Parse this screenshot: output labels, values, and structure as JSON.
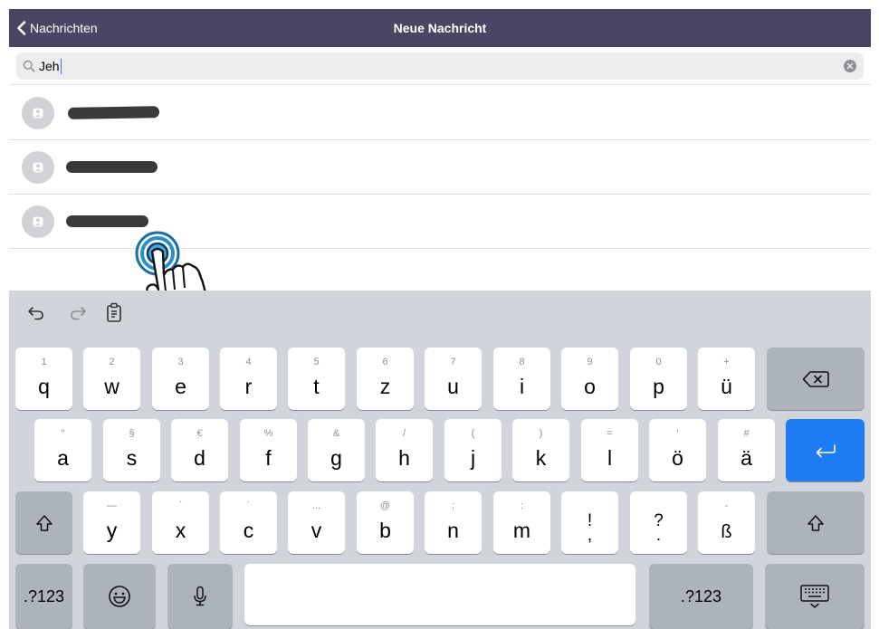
{
  "navbar": {
    "back_label": "Nachrichten",
    "title": "Neue Nachricht",
    "bg_color": "#4a4563"
  },
  "search": {
    "value": "Jeh",
    "icon": "search-icon",
    "clear_icon": "clear-icon"
  },
  "contacts": [
    {
      "name": "",
      "avatar_icon": "person-icon",
      "redacted": true
    },
    {
      "name": "",
      "avatar_icon": "person-icon",
      "redacted": true
    },
    {
      "name": "",
      "avatar_icon": "person-icon",
      "redacted": true
    }
  ],
  "overlay": {
    "icon": "tap-gesture-hand-icon"
  },
  "keyboard": {
    "toolbar": [
      "undo-icon",
      "redo-icon",
      "paste-icon"
    ],
    "row1": [
      {
        "primary": "q",
        "secondary": "1"
      },
      {
        "primary": "w",
        "secondary": "2"
      },
      {
        "primary": "e",
        "secondary": "3"
      },
      {
        "primary": "r",
        "secondary": "4"
      },
      {
        "primary": "t",
        "secondary": "5"
      },
      {
        "primary": "z",
        "secondary": "6"
      },
      {
        "primary": "u",
        "secondary": "7"
      },
      {
        "primary": "i",
        "secondary": "8"
      },
      {
        "primary": "o",
        "secondary": "9"
      },
      {
        "primary": "p",
        "secondary": "0"
      },
      {
        "primary": "ü",
        "secondary": "+"
      }
    ],
    "row2": [
      {
        "primary": "a",
        "secondary": "\""
      },
      {
        "primary": "s",
        "secondary": "§"
      },
      {
        "primary": "d",
        "secondary": "€"
      },
      {
        "primary": "f",
        "secondary": "%"
      },
      {
        "primary": "g",
        "secondary": "&"
      },
      {
        "primary": "h",
        "secondary": "/"
      },
      {
        "primary": "j",
        "secondary": "("
      },
      {
        "primary": "k",
        "secondary": ")"
      },
      {
        "primary": "l",
        "secondary": "="
      },
      {
        "primary": "ö",
        "secondary": "'"
      },
      {
        "primary": "ä",
        "secondary": "#"
      }
    ],
    "row3": [
      {
        "primary": "y",
        "secondary": "—"
      },
      {
        "primary": "x",
        "secondary": "`"
      },
      {
        "primary": "c",
        "secondary": "´"
      },
      {
        "primary": "v",
        "secondary": "..."
      },
      {
        "primary": "b",
        "secondary": "@"
      },
      {
        "primary": "n",
        "secondary": ";"
      },
      {
        "primary": "m",
        "secondary": ":"
      },
      {
        "primary": "!\n,",
        "secondary": ""
      },
      {
        "primary": "?\n.",
        "secondary": ""
      },
      {
        "primary": "ß",
        "secondary": "-"
      }
    ],
    "numbers_label": ".?123",
    "numbers_label_right": ".?123",
    "return_color": "#1d7cf3",
    "icons": {
      "backspace": "backspace-icon",
      "return": "return-icon",
      "shift": "shift-icon",
      "emoji": "emoji-icon",
      "mic": "microphone-icon",
      "dismiss": "keyboard-dismiss-icon"
    }
  }
}
